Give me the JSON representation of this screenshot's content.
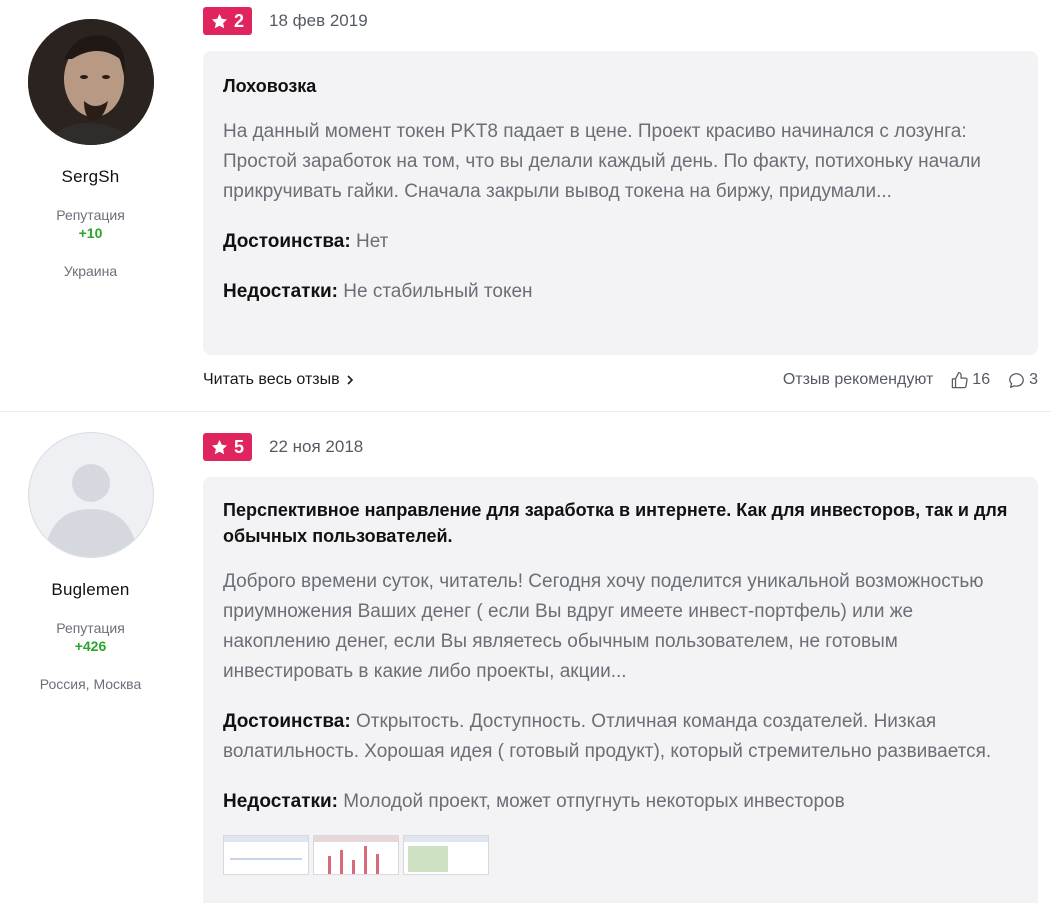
{
  "reviews": [
    {
      "author": {
        "name": "SergSh",
        "reputation_label": "Репутация",
        "reputation_value": "+10",
        "country": "Украина",
        "avatar_icon": "user-photo-avatar"
      },
      "rating": "2",
      "date": "18 фев 2019",
      "title": "Лоховозка",
      "text": "На данный момент токен PKT8 падает в цене. Проект красиво начинался с лозунга: Простой заработок на том, что вы делали каждый день. По факту, потихоньку начали прикручивать гайки. Сначала закрыли вывод токена на биржу, придумали...",
      "pros_label": "Достоинства:",
      "pros_text": "Нет",
      "cons_label": "Недостатки:",
      "cons_text": "Не стабильный токен",
      "read_more": "Читать весь отзыв",
      "recommend": "Отзыв рекомендуют",
      "likes": "16",
      "comments": "3"
    },
    {
      "author": {
        "name": "Buglemen",
        "reputation_label": "Репутация",
        "reputation_value": "+426",
        "country": "Россия, Москва",
        "avatar_icon": "default-avatar"
      },
      "rating": "5",
      "date": "22 ноя 2018",
      "title": "Перспективное направление для заработка в интернете. Как для инвесторов, так и для обычных пользователей.",
      "text": "Доброго времени суток, читатель! Сегодня хочу поделится уникальной возможностью приумножения Ваших денег ( если Вы вдруг имеете инвест-портфель) или же накоплению денег, если Вы являетесь обычным пользователем, не готовым инвестировать в какие либо проекты, акции...",
      "pros_label": "Достоинства:",
      "pros_text": "Открытость. Доступность. Отличная команда создателей. Низкая волатильность. Хорошая идея ( готовый продукт), который стремительно развивается.",
      "cons_label": "Недостатки:",
      "cons_text": "Молодой проект, может отпугнуть некоторых инвесторов"
    }
  ],
  "colors": {
    "badge": "#e0245e",
    "reputation": "#2aa52a",
    "card_bg": "#f3f3f5"
  }
}
